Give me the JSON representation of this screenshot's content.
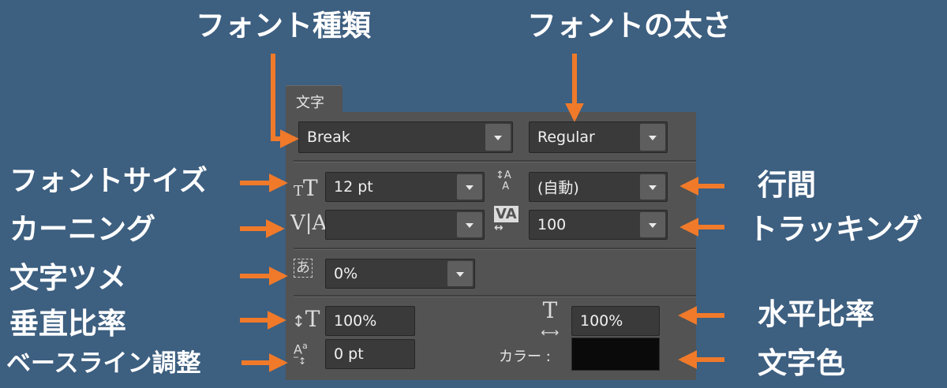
{
  "callouts": {
    "font_family": "フォント種類",
    "font_weight": "フォントの太さ",
    "font_size": "フォントサイズ",
    "kerning": "カーニング",
    "tsume": "文字ツメ",
    "vertical_scale": "垂直比率",
    "baseline": "ベースライン調整",
    "leading": "行間",
    "tracking": "トラッキング",
    "horizontal_scale": "水平比率",
    "text_color": "文字色"
  },
  "panel": {
    "tab_label": "文字",
    "font_family": "Break",
    "font_style": "Regular",
    "font_size": "12 pt",
    "leading": "(自動)",
    "kerning": "",
    "tracking": "100",
    "tsume": "0%",
    "vertical_scale": "100%",
    "horizontal_scale": "100%",
    "baseline_shift": "0 pt",
    "color_label": "カラー :"
  },
  "colors": {
    "background": "#3d5f80",
    "arrow": "#f07a2a",
    "panel": "#535353",
    "text_color_swatch": "#0a0a0a"
  },
  "icons": [
    "font-size-icon",
    "leading-icon",
    "kerning-icon",
    "tracking-icon",
    "tsume-icon",
    "vertical-scale-icon",
    "horizontal-scale-icon",
    "baseline-shift-icon"
  ]
}
